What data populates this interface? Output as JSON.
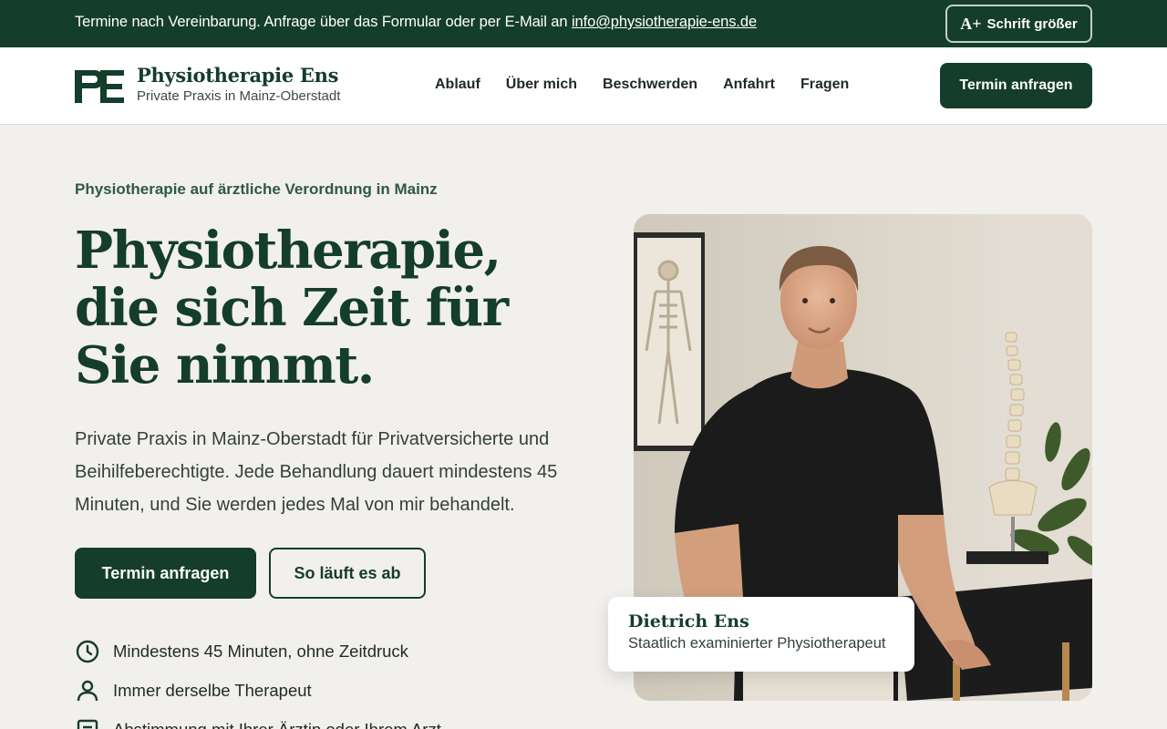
{
  "topbar": {
    "text": "Termine nach Vereinbarung. Anfrage über das Formular oder per E-Mail an ",
    "email": "info@physiotherapie-ens.de",
    "font_button_icon": "A+",
    "font_button_label": "Schrift größer"
  },
  "header": {
    "logo_icon": "pe-monogram-logo",
    "brand_name": "Physiotherapie Ens",
    "brand_sub": "Private Praxis in Mainz-Oberstadt",
    "nav": [
      "Ablauf",
      "Über mich",
      "Beschwerden",
      "Anfahrt",
      "Fragen"
    ],
    "cta": "Termin anfragen"
  },
  "hero": {
    "eyebrow": "Physiotherapie auf ärztliche Verordnung in Mainz",
    "title": "Physiotherapie, die sich Zeit für Sie nimmt.",
    "text": "Private Praxis in Mainz-Oberstadt für Privatversicherte und Beihilfeberechtigte. Jede Behandlung dauert mindestens 45 Minuten, und Sie werden jedes Mal von mir behandelt.",
    "primary_button": "Termin anfragen",
    "secondary_button": "So läuft es ab",
    "features": [
      {
        "icon": "clock-icon",
        "label": "Mindestens 45 Minuten, ohne Zeitdruck"
      },
      {
        "icon": "person-icon",
        "label": "Immer derselbe Therapeut"
      },
      {
        "icon": "document-icon",
        "label": "Abstimmung mit Ihrer Ärztin oder Ihrem Arzt"
      }
    ]
  },
  "photo": {
    "caption_name": "Dietrich Ens",
    "caption_role": "Staatlich examinierter Physiotherapeut"
  },
  "colors": {
    "brand_green": "#143d2b",
    "accent_green": "#2e5a44",
    "background": "#f2f0ec"
  }
}
